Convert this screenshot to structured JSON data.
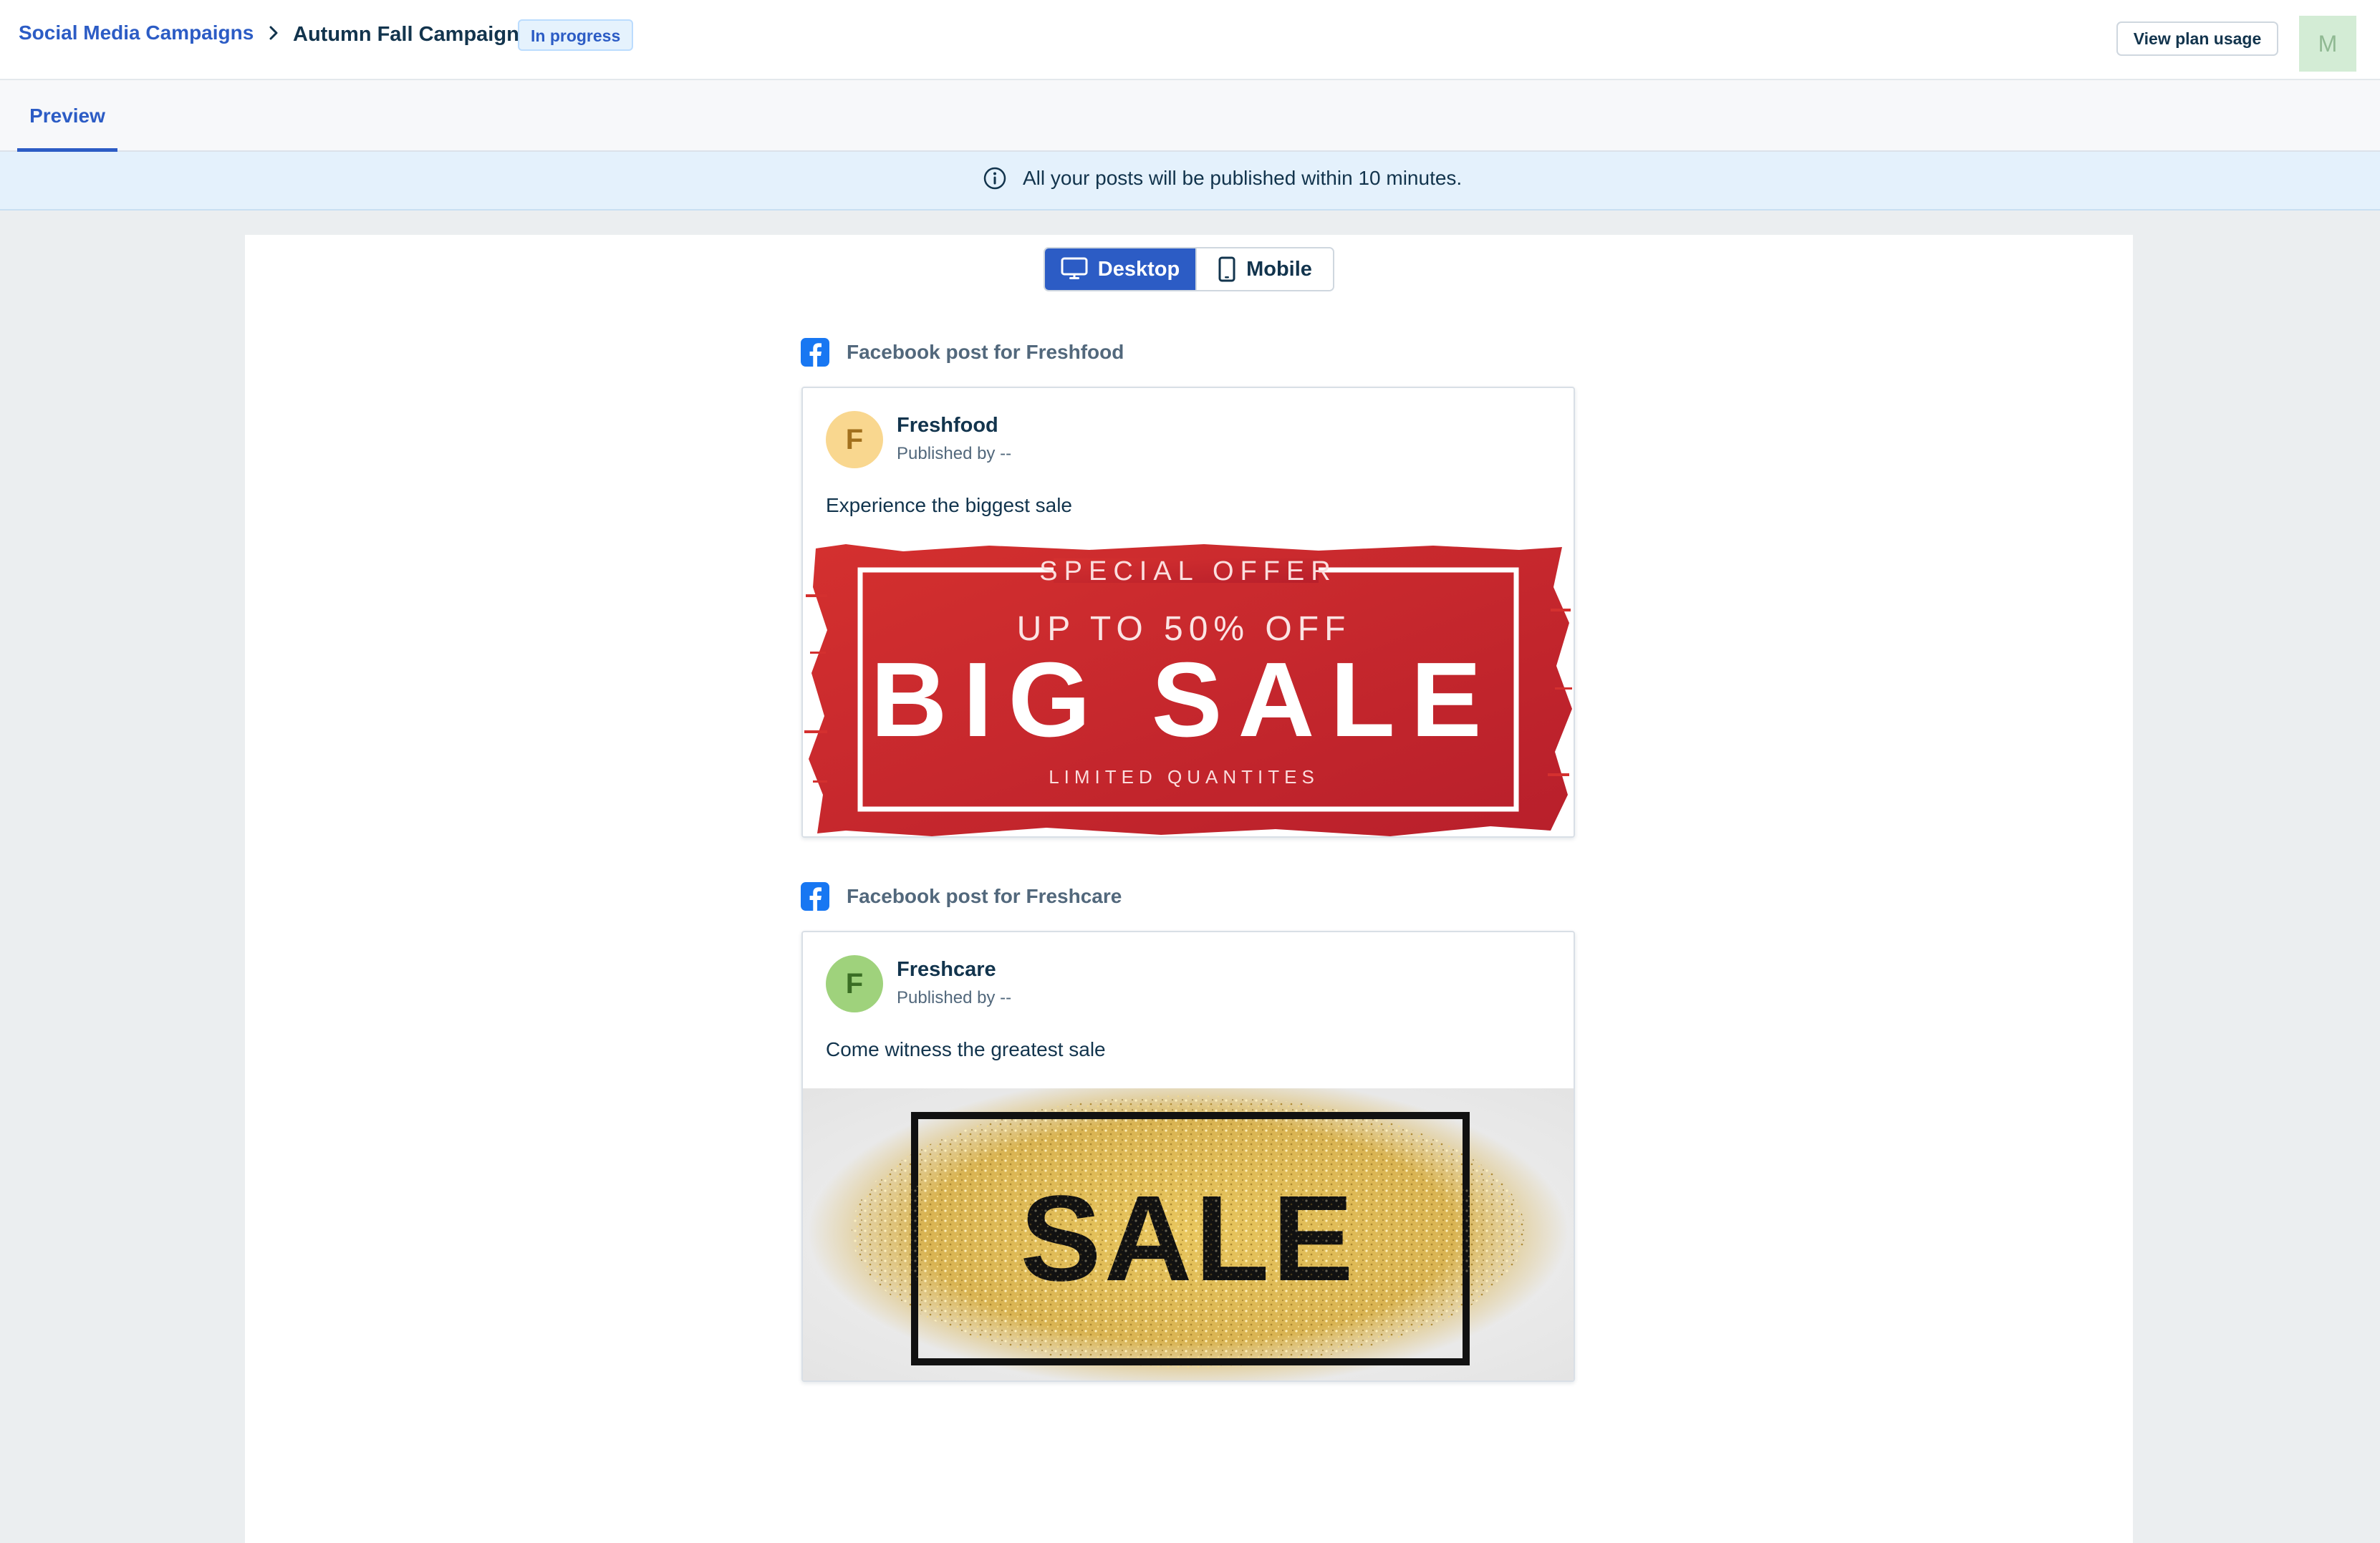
{
  "header": {
    "breadcrumb_root": "Social Media Campaigns",
    "breadcrumb_current": "Autumn Fall Campaign",
    "status": "In progress",
    "plan_button": "View plan usage",
    "avatar_initial": "M"
  },
  "tabs": [
    {
      "label": "Preview",
      "active": true
    }
  ],
  "banner": {
    "text": "All your posts will be published within 10 minutes."
  },
  "view_toggle": {
    "options": [
      {
        "label": "Desktop",
        "icon": "desktop-icon",
        "selected": true
      },
      {
        "label": "Mobile",
        "icon": "mobile-icon",
        "selected": false
      }
    ]
  },
  "posts": [
    {
      "label": "Facebook post for Freshfood",
      "page_name": "Freshfood",
      "avatar_initial": "F",
      "published_by": "Published by --",
      "text": "Experience the biggest sale",
      "image": {
        "line1": "SPECIAL  OFFER",
        "line2": "UP TO 50% OFF",
        "line3": "BIG SALE",
        "line4": "LIMITED QUANTITES"
      }
    },
    {
      "label": "Facebook post for Freshcare",
      "page_name": "Freshcare",
      "avatar_initial": "F",
      "published_by": "Published by --",
      "text": "Come witness the greatest sale",
      "image": {
        "line1": "SALE"
      }
    }
  ],
  "colors": {
    "accent": "#2c5cc5",
    "banner_bg": "#e4f1fc",
    "avatar_freshfood": "#f9d78f",
    "avatar_freshcare": "#9fd27c",
    "facebook": "#1877f2",
    "sale_red": "#c9262c",
    "glitter_gold": "#d9b453"
  }
}
